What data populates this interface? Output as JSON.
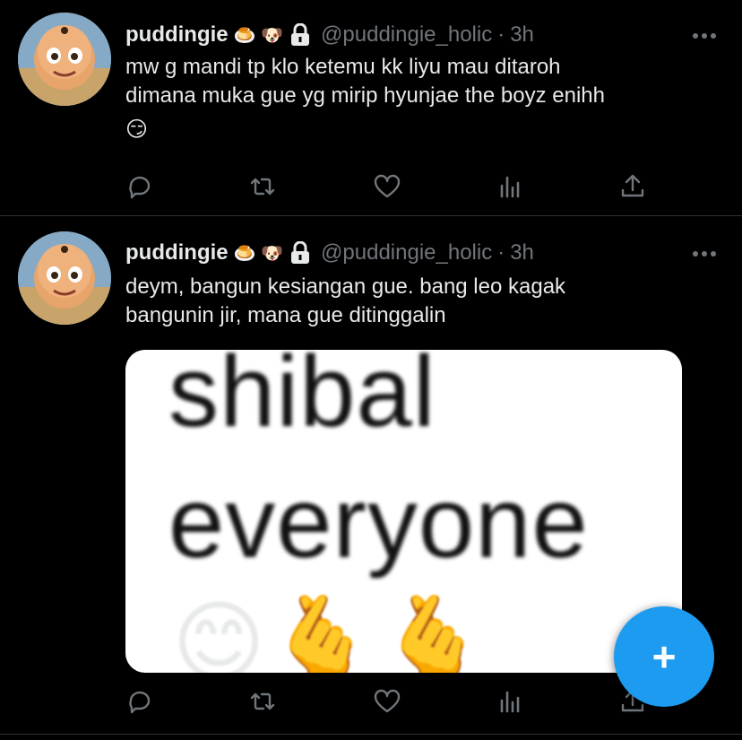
{
  "tweets": [
    {
      "display_name": "puddingie",
      "name_emojis": "🍮 🐶",
      "handle": "@puddingie_holic",
      "separator": "·",
      "time": "3h",
      "text_line1": "mw g mandi tp klo ketemu kk liyu mau ditaroh",
      "text_line2": "dimana muka gue yg mirip hyunjae the boyz enihh",
      "text_emoji": "😏"
    },
    {
      "display_name": "puddingie",
      "name_emojis": "🍮 🐶",
      "handle": "@puddingie_holic",
      "separator": "·",
      "time": "3h",
      "text_line1": "deym, bangun kesiangan gue.  bang leo kagak",
      "text_line2": "bangunin jir, mana gue ditinggalin",
      "media": {
        "line1": "shibal",
        "line2": "everyone",
        "emojis": "😊🫰🫰"
      }
    }
  ],
  "icons": {
    "reply": "reply-icon",
    "retweet": "retweet-icon",
    "like": "like-icon",
    "views": "views-icon",
    "share": "share-icon",
    "more": "more-icon",
    "lock": "lock-icon",
    "compose": "compose-plus-icon"
  },
  "colors": {
    "background": "#000000",
    "text": "#e7e9ea",
    "muted": "#71767b",
    "accent": "#1d9bf0",
    "divider": "#2f3336"
  },
  "fab": {
    "label": "+"
  }
}
